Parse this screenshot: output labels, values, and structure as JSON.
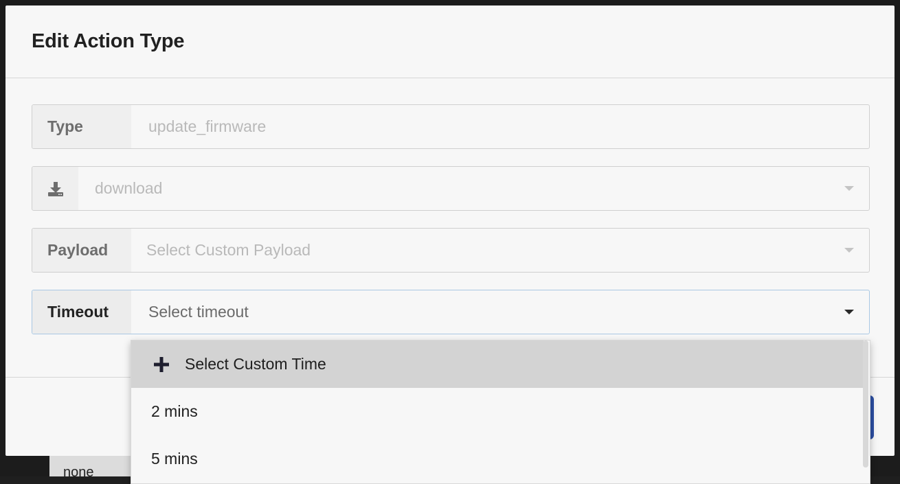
{
  "background": {
    "peek_text": "none"
  },
  "modal": {
    "title": "Edit Action Type",
    "type_field": {
      "label": "Type",
      "value": "update_firmware"
    },
    "download_field": {
      "icon": "download-icon",
      "value": "download"
    },
    "payload_field": {
      "label": "Payload",
      "placeholder": "Select Custom Payload"
    },
    "timeout_field": {
      "label": "Timeout",
      "placeholder": "Select timeout"
    }
  },
  "timeout_dropdown": {
    "items": [
      {
        "icon": "plus-icon",
        "label": "Select Custom Time",
        "highlighted": true
      },
      {
        "label": "2 mins"
      },
      {
        "label": "5 mins"
      }
    ]
  },
  "colors": {
    "accent_button": "#2c4fa3",
    "highlight_row": "#d3d3d3",
    "active_border": "#a9c7e3"
  }
}
